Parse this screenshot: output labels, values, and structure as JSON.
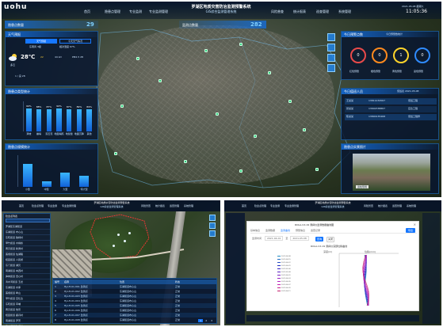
{
  "main": {
    "logo": "uohu",
    "title": "罗湖区地质灾害防治监测预警系统",
    "subtitle": "GIS综合监测管理系统",
    "nav_left": [
      "首页",
      "隐患点管理",
      "专业监测",
      "专业监测管理"
    ],
    "nav_right": [
      "风险普查",
      "统计报表",
      "巡查管理",
      "系统管理"
    ],
    "date": "2021-05-08 星期六",
    "time": "11:05:36",
    "left_count_label": "隐患点数量",
    "left_count": "29",
    "center_count_label": "监测点数量",
    "center_count": "282",
    "weather": {
      "panel_title": "天气预报",
      "tabs": [
        "天气预报",
        "今天天气情况"
      ],
      "temp": "28℃",
      "city": "多云",
      "metrics": [
        "东南风 3级",
        "相对湿度 67%",
        "22",
        "44 km",
        "PM2.5 28"
      ],
      "aqi": "1 / 良 28"
    },
    "bar1": {
      "title": "隐患点类型统计",
      "categories": [
        "滑坡",
        "崩塌",
        "泥石流",
        "地面塌陷",
        "地裂缝",
        "地面沉降",
        "其他"
      ],
      "value_labels": [
        "90%",
        "88%",
        "87%",
        "90%",
        "87%",
        "89%",
        "89%"
      ],
      "values": [
        90,
        88,
        87,
        90,
        87,
        89,
        89
      ],
      "color": "#1f8ff0"
    },
    "bar2": {
      "title": "隐患点规模统计",
      "categories": [
        "小型",
        "中型",
        "大型",
        "特大型"
      ],
      "value_labels": [
        "",
        "",
        "",
        ""
      ],
      "values": [
        85,
        22,
        52,
        42
      ],
      "color": "#1f8ff0"
    },
    "right_top": {
      "title": "今日预警点数",
      "right_title": "今日预警数统计",
      "rings": [
        {
          "value": "0",
          "color": "#e84a4a",
          "label": "红色预警"
        },
        {
          "value": "0",
          "color": "#ff8a1e",
          "label": "橙色预警"
        },
        {
          "value": "1",
          "color": "#ffd42a",
          "label": "黄色预警"
        },
        {
          "value": "0",
          "color": "#2f8bff",
          "label": "蓝色预警"
        }
      ]
    },
    "duty": {
      "title": "今日值班人员",
      "right": "值班表 2021-05-08",
      "rows": [
        [
          "王某某",
          "13811234567",
          "值班工程"
        ],
        [
          "张某某",
          "13602338867",
          "应急工程"
        ],
        [
          "陈某某",
          "13800135468",
          "值班工程师"
        ]
      ]
    },
    "video": {
      "title": "隐患点实景照片",
      "caption": "巡检现场"
    },
    "sidebar_icons": [
      "layers-icon",
      "measure-icon",
      "locate-icon",
      "fullscreen-icon"
    ],
    "accent": "#1f8ff0"
  },
  "detail": {
    "title": "罗湖区地质灾害防治监测预警系统",
    "subtitle": "GIS综合监测管理系统",
    "nav": [
      "首页",
      "隐患点管理",
      "专业监测",
      "专业监测管理",
      "风险普查",
      "统计报表",
      "巡查管理",
      "系统管理"
    ],
    "list_header": "隐患点列表",
    "list_items": [
      "罗湖区东湖街道",
      "东湖街道 布心山",
      "东晓街道 独树村",
      "翠竹街道 木棉岭",
      "黄贝街道 新秀村",
      "莲塘街道 仙湖路",
      "桂园街道 人民桥",
      "东门街道 湖贝",
      "南湖街道 向西村",
      "笋岗街道 田心村",
      "清水河街道 玉龙",
      "东湖街道 水库",
      "莲塘街道 畔山",
      "翠竹街道 百仕达",
      "东晓街道 草埔",
      "黄贝街道 怡景",
      "桂园街道 鹿丹村",
      "南湖街道 罗芳",
      "清水河街道 坭岗",
      "东湖街道 大望"
    ],
    "table": {
      "header": [
        "编号",
        "名称",
        "位置",
        "状态"
      ],
      "rows": [
        [
          "1",
          "HJ-LH-01-001 监测点",
          "东湖街道布心山",
          "正常"
        ],
        [
          "2",
          "HJ-LH-01-002 监测点",
          "东湖街道布心山",
          "正常"
        ],
        [
          "3",
          "HJ-LH-01-003 监测点",
          "东湖街道布心山",
          "正常"
        ],
        [
          "4",
          "HJ-LH-01-004 监测点",
          "东湖街道布心山",
          "正常"
        ],
        [
          "5",
          "HJ-LH-01-005 监测点",
          "东湖街道布心山",
          "正常"
        ],
        [
          "6",
          "HJ-LH-01-006 监测点",
          "东湖街道布心山",
          "正常"
        ],
        [
          "7",
          "HJ-LH-01-007 监测点",
          "东湖街道布心山",
          "正常"
        ],
        [
          "8",
          "HJ-LH-01-008 监测点",
          "东湖街道布心山",
          "正常"
        ]
      ],
      "pager": [
        "1",
        "2",
        "3"
      ]
    }
  },
  "chart": {
    "title": "罗湖区地质灾害防治监测预警系统",
    "subtitle": "GIS综合监测管理系统",
    "nav": [
      "首页",
      "隐患点管理",
      "专业监测",
      "专业监测管理",
      "风险普查",
      "统计报表",
      "巡查管理",
      "系统管理"
    ],
    "modal_title": "ROLA-CX-19 测斜仪监测数据曲线图",
    "tabs": [
      "基本信息",
      "监测数据",
      "监测曲线",
      "预警信息",
      "巡查记录"
    ],
    "filters": [
      "监测时间",
      "2021-04-01",
      "至",
      "2021-05-08"
    ],
    "query_label": "查询",
    "export_label": "导出",
    "close_label": "关闭",
    "chart_title": "ROLA-CX-19 测斜仪深部位移曲线",
    "legend": [
      "2021-04-08",
      "2021-04-15",
      "2021-04-22",
      "2021-04-29",
      "2021-05-06",
      "2021-05-08",
      "2021-04-01",
      "2021-04-03",
      "2021-04-05",
      "2021-04-07",
      "2021-04-09",
      "2021-04-11"
    ],
    "ylabel": "深度(m)",
    "xlabel": "位移(mm)"
  }
}
